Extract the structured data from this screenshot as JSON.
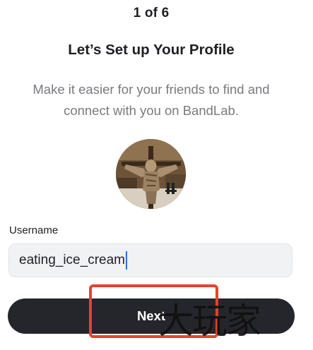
{
  "progress": {
    "step_text": "1 of 6",
    "current_step": 1,
    "total_steps": 6
  },
  "header": {
    "title": "Let’s Set up Your Profile",
    "subtitle": "Make it easier for your friends to find and connect with you on BandLab."
  },
  "avatar": {
    "description_icon": "profile-photo"
  },
  "username": {
    "label": "Username",
    "value": "eating_ice_cream"
  },
  "actions": {
    "next_label": "Next"
  },
  "overlay": {
    "watermark_text": "大玩家",
    "highlight_color": "#e8412b"
  }
}
